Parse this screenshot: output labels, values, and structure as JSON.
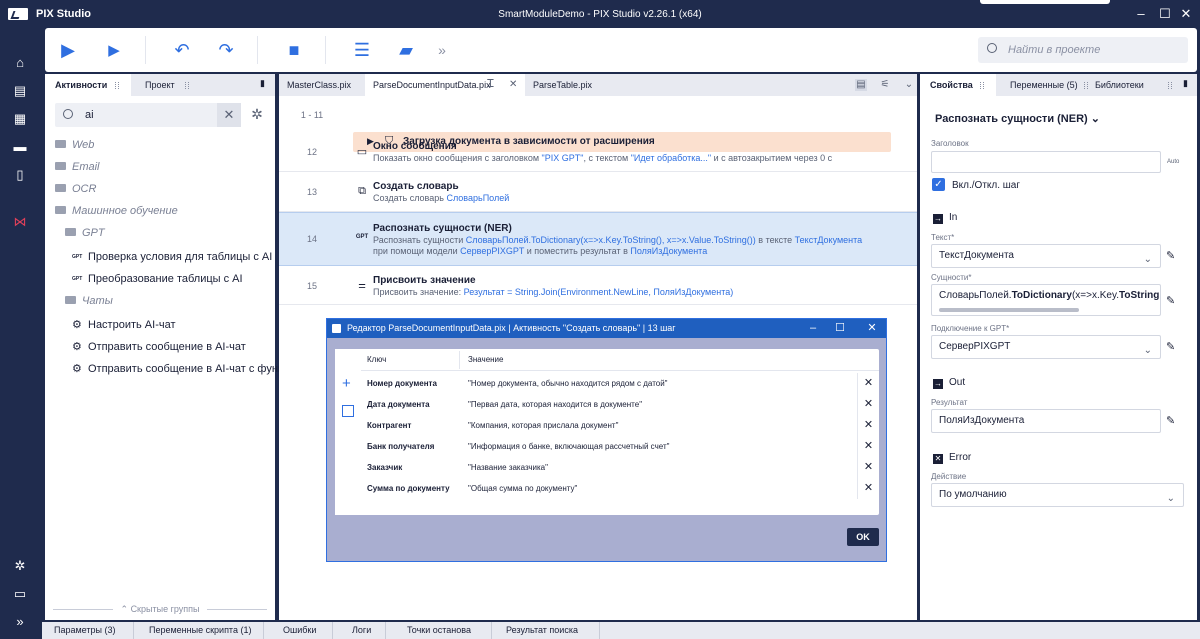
{
  "app": {
    "name": "PIX Studio",
    "window_title": "SmartModuleDemo - PIX Studio v2.26.1 (x64)"
  },
  "toolbar": {
    "search_placeholder": "Найти в проекте"
  },
  "left_panel": {
    "tabs": [
      "Активности",
      "Проект"
    ],
    "search_value": "ai",
    "tree": [
      {
        "label": "Web",
        "kind": "category"
      },
      {
        "label": "Email",
        "kind": "category"
      },
      {
        "label": "OCR",
        "kind": "category"
      },
      {
        "label": "Машинное обучение",
        "kind": "category"
      },
      {
        "label": "GPT",
        "kind": "category"
      },
      {
        "label": "Проверка условия для таблицы с AI",
        "kind": "activity",
        "badge": "GPT"
      },
      {
        "label": "Преобразование таблицы с AI",
        "kind": "activity",
        "badge": "GPT"
      },
      {
        "label": "Чаты",
        "kind": "category"
      },
      {
        "label": "Настроить AI-чат",
        "kind": "activity"
      },
      {
        "label": "Отправить сообщение в AI-чат",
        "kind": "activity"
      },
      {
        "label": "Отправить сообщение в AI-чат с функ...",
        "kind": "activity"
      }
    ],
    "hidden_groups": "Скрытые группы"
  },
  "editor": {
    "tabs": [
      "MasterClass.pix",
      "ParseDocumentInputData.pix",
      "ParseTable.pix"
    ],
    "rows": [
      {
        "num": "1 - 11",
        "title": "Загрузка документа в зависимости от расширения",
        "group": true
      },
      {
        "num": "12",
        "title": "Окно сообщения",
        "desc": [
          "Показать окно сообщения с заголовком ",
          "\"PIX GPT\"",
          ", с текстом ",
          "\"Идет обработка...\"",
          " и с автозакрытием через 0 с"
        ]
      },
      {
        "num": "13",
        "title": "Создать словарь",
        "desc": [
          "Создать словарь ",
          "СловарьПолей"
        ]
      },
      {
        "num": "14",
        "title": "Распознать сущности (NER)",
        "desc": [
          "Распознать сущности ",
          "СловарьПолей.ToDictionary(x=>x.Key.ToString(), x=>x.Value.ToString())",
          " в тексте ",
          "ТекстДокумента"
        ],
        "desc2": [
          "при помощи модели ",
          "СерверPIXGPT",
          " и поместить результат в ",
          "ПоляИзДокумента"
        ]
      },
      {
        "num": "15",
        "title": "Присвоить значение",
        "desc": [
          "Присвоить значение: ",
          "Результат = String.Join(Environment.NewLine, ПоляИзДокумента)"
        ]
      }
    ]
  },
  "right_panel": {
    "tabs": [
      "Свойства",
      "Переменные (5)",
      "Библиотеки"
    ],
    "activity_title": "Распознать сущности (NER)",
    "header_label": "Заголовок",
    "header_value": "",
    "auto_label": "Auto",
    "toggle_label": "Вкл./Откл. шаг",
    "in_label": "In",
    "text_label": "Текст*",
    "text_value": "ТекстДокумента",
    "entities_label": "Сущности*",
    "entities_value_a": "СловарьПолей.",
    "entities_value_b": "ToDictionary",
    "entities_value_c": "(x=>x.Key.",
    "entities_value_d": "ToString",
    "gpt_label": "Подключение к GPT*",
    "gpt_value": "СерверPIXGPT",
    "out_label": "Out",
    "result_label": "Результат",
    "result_value": "ПоляИзДокумента",
    "error_label": "Error",
    "action_label": "Действие",
    "action_value": "По умолчанию"
  },
  "bottom_tabs": [
    "Параметры (3)",
    "Переменные скрипта (1)",
    "Ошибки",
    "Логи",
    "Точки останова",
    "Результат поиска"
  ],
  "dialog": {
    "title": "Редактор ParseDocumentInputData.pix | Активность \"Создать словарь\" | 13 шаг",
    "col_key": "Ключ",
    "col_value": "Значение",
    "rows": [
      {
        "key": "Номер документа",
        "value": "\"Номер документа, обычно находится рядом с датой\""
      },
      {
        "key": "Дата документа",
        "value": "\"Первая дата, которая находится в документе\""
      },
      {
        "key": "Контрагент",
        "value": "\"Компания, которая прислала документ\""
      },
      {
        "key": "Банк получателя",
        "value": "\"Информация о банке, включающая рассчетный счет\""
      },
      {
        "key": "Заказчик",
        "value": "\"Название заказчика\""
      },
      {
        "key": "Сумма по документу",
        "value": "\"Общая сумма по документу\""
      }
    ],
    "ok_label": "OK"
  },
  "colors": {
    "primary_dark": "#1f2b4d",
    "accent": "#2f6fe0",
    "selection": "#dbe8f8",
    "group_bar": "#fbe0cf",
    "dialog_title": "#1f5fbf"
  }
}
